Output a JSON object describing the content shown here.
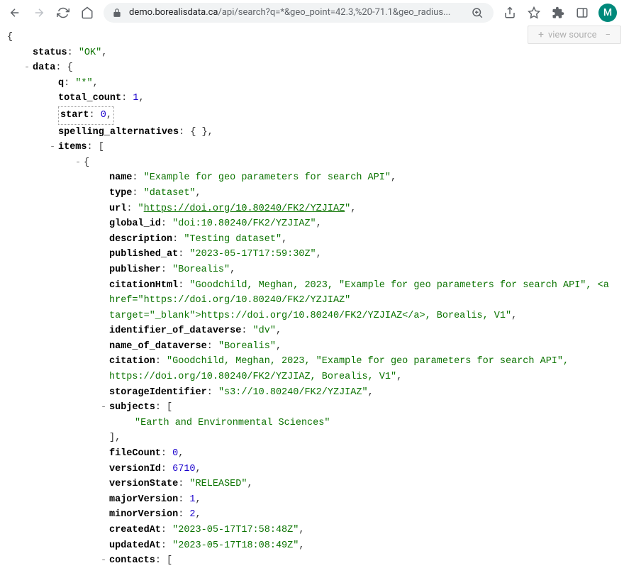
{
  "toolbar": {
    "url_domain": "demo.borealisdata.ca",
    "url_path": "/api/search?q=*&geo_point=42.3,%20-71.1&geo_radius...",
    "avatar_letter": "M"
  },
  "view_source_label": "view source",
  "json": {
    "status": {
      "key": "status",
      "value": "\"OK\""
    },
    "data_key": "data",
    "q": {
      "key": "q",
      "value": "\"*\""
    },
    "total_count": {
      "key": "total_count",
      "value": "1"
    },
    "start": {
      "key": "start",
      "value": "0"
    },
    "spelling_alternatives": {
      "key": "spelling_alternatives"
    },
    "items_key": "items",
    "item": {
      "name": {
        "key": "name",
        "value": "\"Example for geo parameters for search API\""
      },
      "type": {
        "key": "type",
        "value": "\"dataset\""
      },
      "url": {
        "key": "url",
        "value": "https://doi.org/10.80240/FK2/YZJIAZ"
      },
      "global_id": {
        "key": "global_id",
        "value": "\"doi:10.80240/FK2/YZJIAZ\""
      },
      "description": {
        "key": "description",
        "value": "\"Testing dataset\""
      },
      "published_at": {
        "key": "published_at",
        "value": "\"2023-05-17T17:59:30Z\""
      },
      "publisher": {
        "key": "publisher",
        "value": "\"Borealis\""
      },
      "citationHtml": {
        "key": "citationHtml",
        "value": "\"Goodchild, Meghan, 2023, \"Example for geo parameters for search API\", <a href=\"https://doi.org/10.80240/FK2/YZJIAZ\" target=\"_blank\">https://doi.org/10.80240/FK2/YZJIAZ</a>, Borealis, V1\""
      },
      "identifier_of_dataverse": {
        "key": "identifier_of_dataverse",
        "value": "\"dv\""
      },
      "name_of_dataverse": {
        "key": "name_of_dataverse",
        "value": "\"Borealis\""
      },
      "citation": {
        "key": "citation",
        "value": "\"Goodchild, Meghan, 2023, \"Example for geo parameters for search API\", https://doi.org/10.80240/FK2/YZJIAZ, Borealis, V1\""
      },
      "storageIdentifier": {
        "key": "storageIdentifier",
        "value": "\"s3://10.80240/FK2/YZJIAZ\""
      },
      "subjects_key": "subjects",
      "subjects_item": "\"Earth and Environmental Sciences\"",
      "fileCount": {
        "key": "fileCount",
        "value": "0"
      },
      "versionId": {
        "key": "versionId",
        "value": "6710"
      },
      "versionState": {
        "key": "versionState",
        "value": "\"RELEASED\""
      },
      "majorVersion": {
        "key": "majorVersion",
        "value": "1"
      },
      "minorVersion": {
        "key": "minorVersion",
        "value": "2"
      },
      "createdAt": {
        "key": "createdAt",
        "value": "\"2023-05-17T17:58:48Z\""
      },
      "updatedAt": {
        "key": "updatedAt",
        "value": "\"2023-05-17T18:08:49Z\""
      },
      "contacts_key": "contacts"
    }
  }
}
